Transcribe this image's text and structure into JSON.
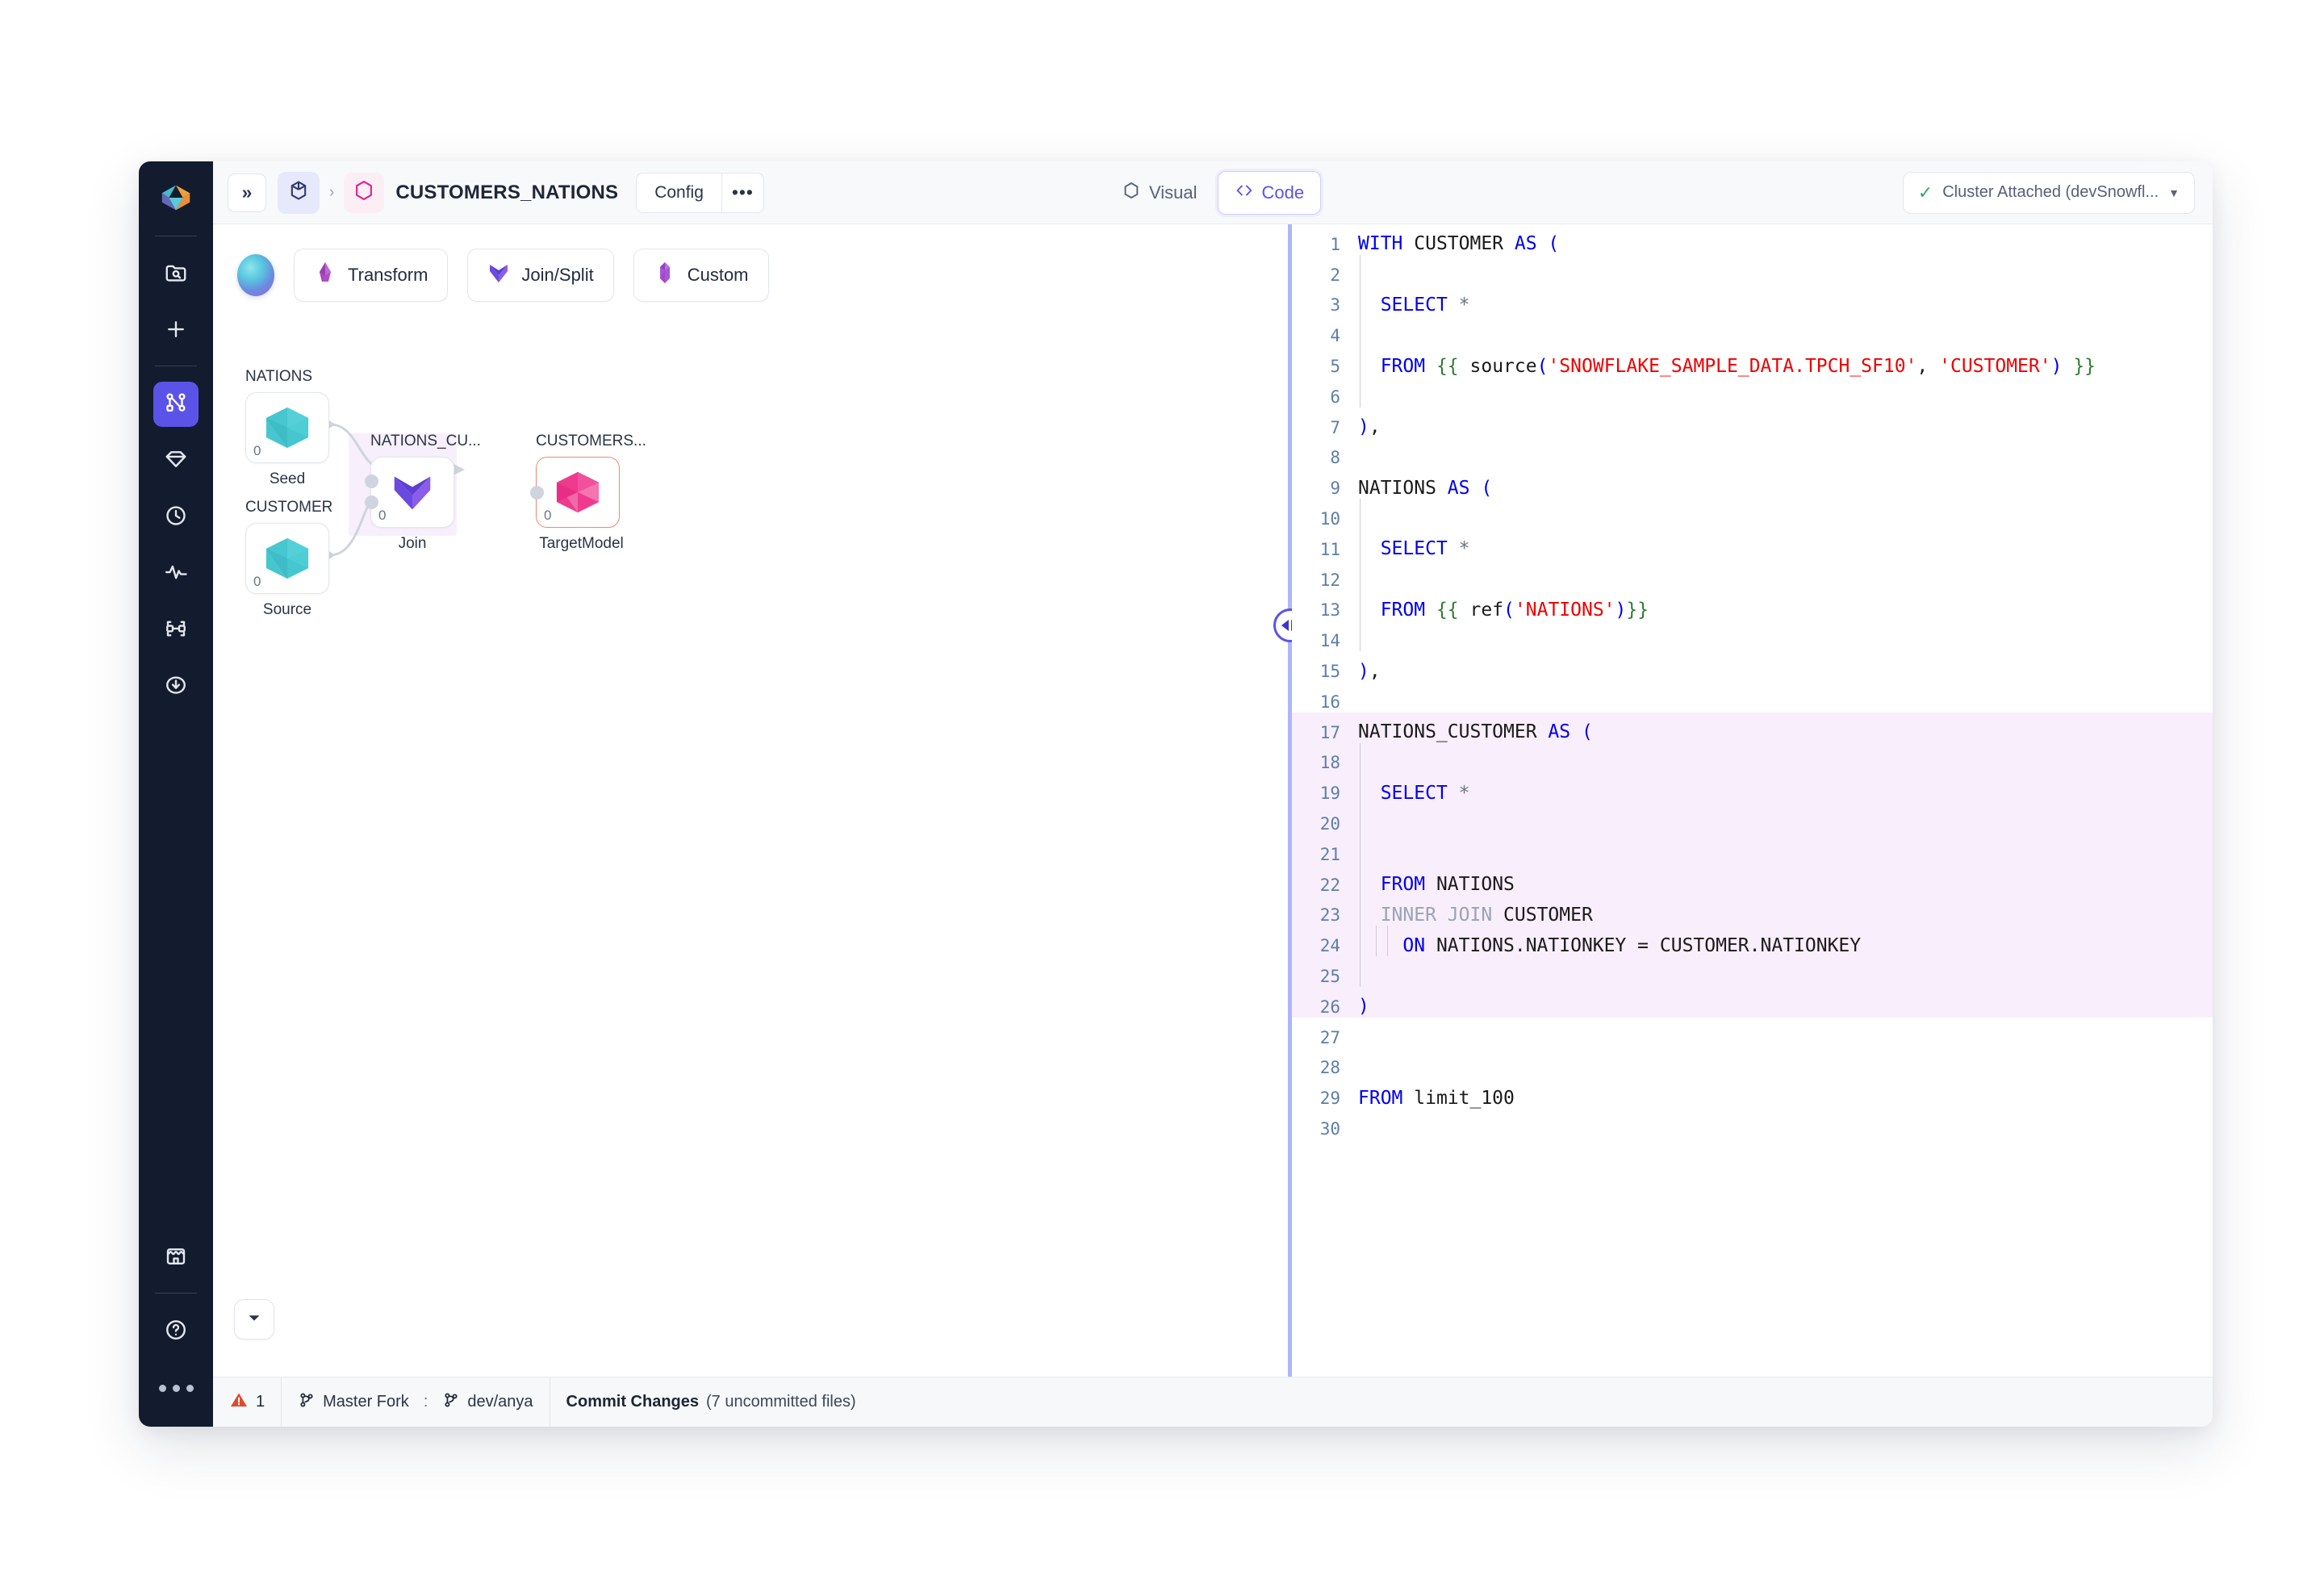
{
  "topbar": {
    "expand_label": "»",
    "breadcrumb_separator": "›",
    "title": "CUSTOMERS_NATIONS",
    "config_label": "Config",
    "more_label": "•••",
    "visual_label": "Visual",
    "code_label": "Code",
    "cluster_check": "✓",
    "cluster_label": "Cluster Attached (devSnowfl...",
    "cluster_caret": "▼"
  },
  "canvas": {
    "tools": [
      {
        "label": "Transform",
        "icon": "transform-gem-icon"
      },
      {
        "label": "Join/Split",
        "icon": "join-split-icon"
      },
      {
        "label": "Custom",
        "icon": "custom-crystal-icon"
      }
    ],
    "fab_icon": "chevron-down-icon",
    "nodes": [
      {
        "title": "NATIONS",
        "count": "0",
        "subtitle": "Seed",
        "type": "seed"
      },
      {
        "title": "CUSTOMER",
        "count": "0",
        "subtitle": "Source",
        "type": "source"
      },
      {
        "title": "NATIONS_CU...",
        "count": "0",
        "subtitle": "Join",
        "type": "join"
      },
      {
        "title": "CUSTOMERS...",
        "count": "0",
        "subtitle": "TargetModel",
        "type": "target"
      }
    ]
  },
  "splitter": {
    "icon": "resize-horizontal-icon"
  },
  "editor": {
    "highlight_start": 17,
    "highlight_end": 26,
    "lines": [
      {
        "n": 1,
        "tokens": [
          {
            "t": "WITH ",
            "c": "kw"
          },
          {
            "t": "CUSTOMER ",
            "c": "plain"
          },
          {
            "t": "AS ",
            "c": "kw"
          },
          {
            "t": "(",
            "c": "kw"
          }
        ]
      },
      {
        "n": 2,
        "tokens": []
      },
      {
        "n": 3,
        "tokens": [
          {
            "t": "  ",
            "c": "plain"
          },
          {
            "t": "SELECT ",
            "c": "kw"
          },
          {
            "t": "*",
            "c": "star"
          }
        ]
      },
      {
        "n": 4,
        "tokens": []
      },
      {
        "n": 5,
        "tokens": [
          {
            "t": "  ",
            "c": "plain"
          },
          {
            "t": "FROM ",
            "c": "kw"
          },
          {
            "t": "{{ ",
            "c": "jinja"
          },
          {
            "t": "source",
            "c": "plain"
          },
          {
            "t": "(",
            "c": "kw"
          },
          {
            "t": "'SNOWFLAKE_SAMPLE_DATA.TPCH_SF10'",
            "c": "str"
          },
          {
            "t": ", ",
            "c": "plain"
          },
          {
            "t": "'CUSTOMER'",
            "c": "str"
          },
          {
            "t": ")",
            "c": "kw"
          },
          {
            "t": " }}",
            "c": "jinja"
          }
        ]
      },
      {
        "n": 6,
        "tokens": []
      },
      {
        "n": 7,
        "tokens": [
          {
            "t": ")",
            "c": "kw"
          },
          {
            "t": ",",
            "c": "plain"
          }
        ]
      },
      {
        "n": 8,
        "tokens": []
      },
      {
        "n": 9,
        "tokens": [
          {
            "t": "NATIONS ",
            "c": "plain"
          },
          {
            "t": "AS ",
            "c": "kw"
          },
          {
            "t": "(",
            "c": "kw"
          }
        ]
      },
      {
        "n": 10,
        "tokens": []
      },
      {
        "n": 11,
        "tokens": [
          {
            "t": "  ",
            "c": "plain"
          },
          {
            "t": "SELECT ",
            "c": "kw"
          },
          {
            "t": "*",
            "c": "star"
          }
        ]
      },
      {
        "n": 12,
        "tokens": []
      },
      {
        "n": 13,
        "tokens": [
          {
            "t": "  ",
            "c": "plain"
          },
          {
            "t": "FROM ",
            "c": "kw"
          },
          {
            "t": "{{ ",
            "c": "jinja"
          },
          {
            "t": "ref",
            "c": "plain"
          },
          {
            "t": "(",
            "c": "kw"
          },
          {
            "t": "'NATIONS'",
            "c": "str"
          },
          {
            "t": ")",
            "c": "kw"
          },
          {
            "t": "}}",
            "c": "jinja"
          }
        ]
      },
      {
        "n": 14,
        "tokens": []
      },
      {
        "n": 15,
        "tokens": [
          {
            "t": ")",
            "c": "kw"
          },
          {
            "t": ",",
            "c": "plain"
          }
        ]
      },
      {
        "n": 16,
        "tokens": []
      },
      {
        "n": 17,
        "tokens": [
          {
            "t": "NATIONS_CUSTOMER ",
            "c": "plain"
          },
          {
            "t": "AS ",
            "c": "kw"
          },
          {
            "t": "(",
            "c": "kw"
          }
        ]
      },
      {
        "n": 18,
        "tokens": []
      },
      {
        "n": 19,
        "tokens": [
          {
            "t": "  ",
            "c": "plain"
          },
          {
            "t": "SELECT ",
            "c": "kw"
          },
          {
            "t": "*",
            "c": "star"
          }
        ]
      },
      {
        "n": 20,
        "tokens": []
      },
      {
        "n": 21,
        "tokens": []
      },
      {
        "n": 22,
        "tokens": [
          {
            "t": "  ",
            "c": "plain"
          },
          {
            "t": "FROM ",
            "c": "kw"
          },
          {
            "t": "NATIONS",
            "c": "plain"
          }
        ]
      },
      {
        "n": 23,
        "tokens": [
          {
            "t": "  ",
            "c": "plain"
          },
          {
            "t": "INNER JOIN ",
            "c": "kw2"
          },
          {
            "t": "CUSTOMER",
            "c": "plain"
          }
        ]
      },
      {
        "n": 24,
        "tokens": [
          {
            "t": "    ",
            "c": "plain"
          },
          {
            "t": "ON ",
            "c": "kw"
          },
          {
            "t": "NATIONS.NATIONKEY = CUSTOMER.NATIONKEY",
            "c": "plain"
          }
        ]
      },
      {
        "n": 25,
        "tokens": []
      },
      {
        "n": 26,
        "tokens": [
          {
            "t": ")",
            "c": "kw"
          }
        ]
      },
      {
        "n": 27,
        "tokens": []
      },
      {
        "n": 28,
        "tokens": []
      },
      {
        "n": 29,
        "tokens": [
          {
            "t": "FROM ",
            "c": "kw"
          },
          {
            "t": "limit_100",
            "c": "plain"
          }
        ]
      },
      {
        "n": 30,
        "tokens": []
      }
    ]
  },
  "statusbar": {
    "warning_count": "1",
    "branch_primary": "Master Fork",
    "branch_divider": ":",
    "branch_secondary": "dev/anya",
    "commit_label": "Commit Changes",
    "commit_detail": "(7 uncommitted files)"
  },
  "sidebar": {
    "items": [
      {
        "name": "search-folder-icon",
        "active": false
      },
      {
        "name": "plus-icon",
        "active": false
      },
      {
        "name": "workflow-graph-icon",
        "active": true
      },
      {
        "name": "diamond-icon",
        "active": false
      },
      {
        "name": "clock-icon",
        "active": false
      },
      {
        "name": "activity-pulse-icon",
        "active": false
      },
      {
        "name": "nodes-network-icon",
        "active": false
      },
      {
        "name": "download-circle-icon",
        "active": false
      },
      {
        "name": "store-icon",
        "active": false
      },
      {
        "name": "help-circle-icon",
        "active": false
      }
    ]
  },
  "colors": {
    "accent": "#5b53e8",
    "rail_bg": "#131c2e",
    "highlight": "#f9eefc",
    "target_border": "#f08a6e",
    "warning": "#e04a2f",
    "ok": "#35a766"
  }
}
